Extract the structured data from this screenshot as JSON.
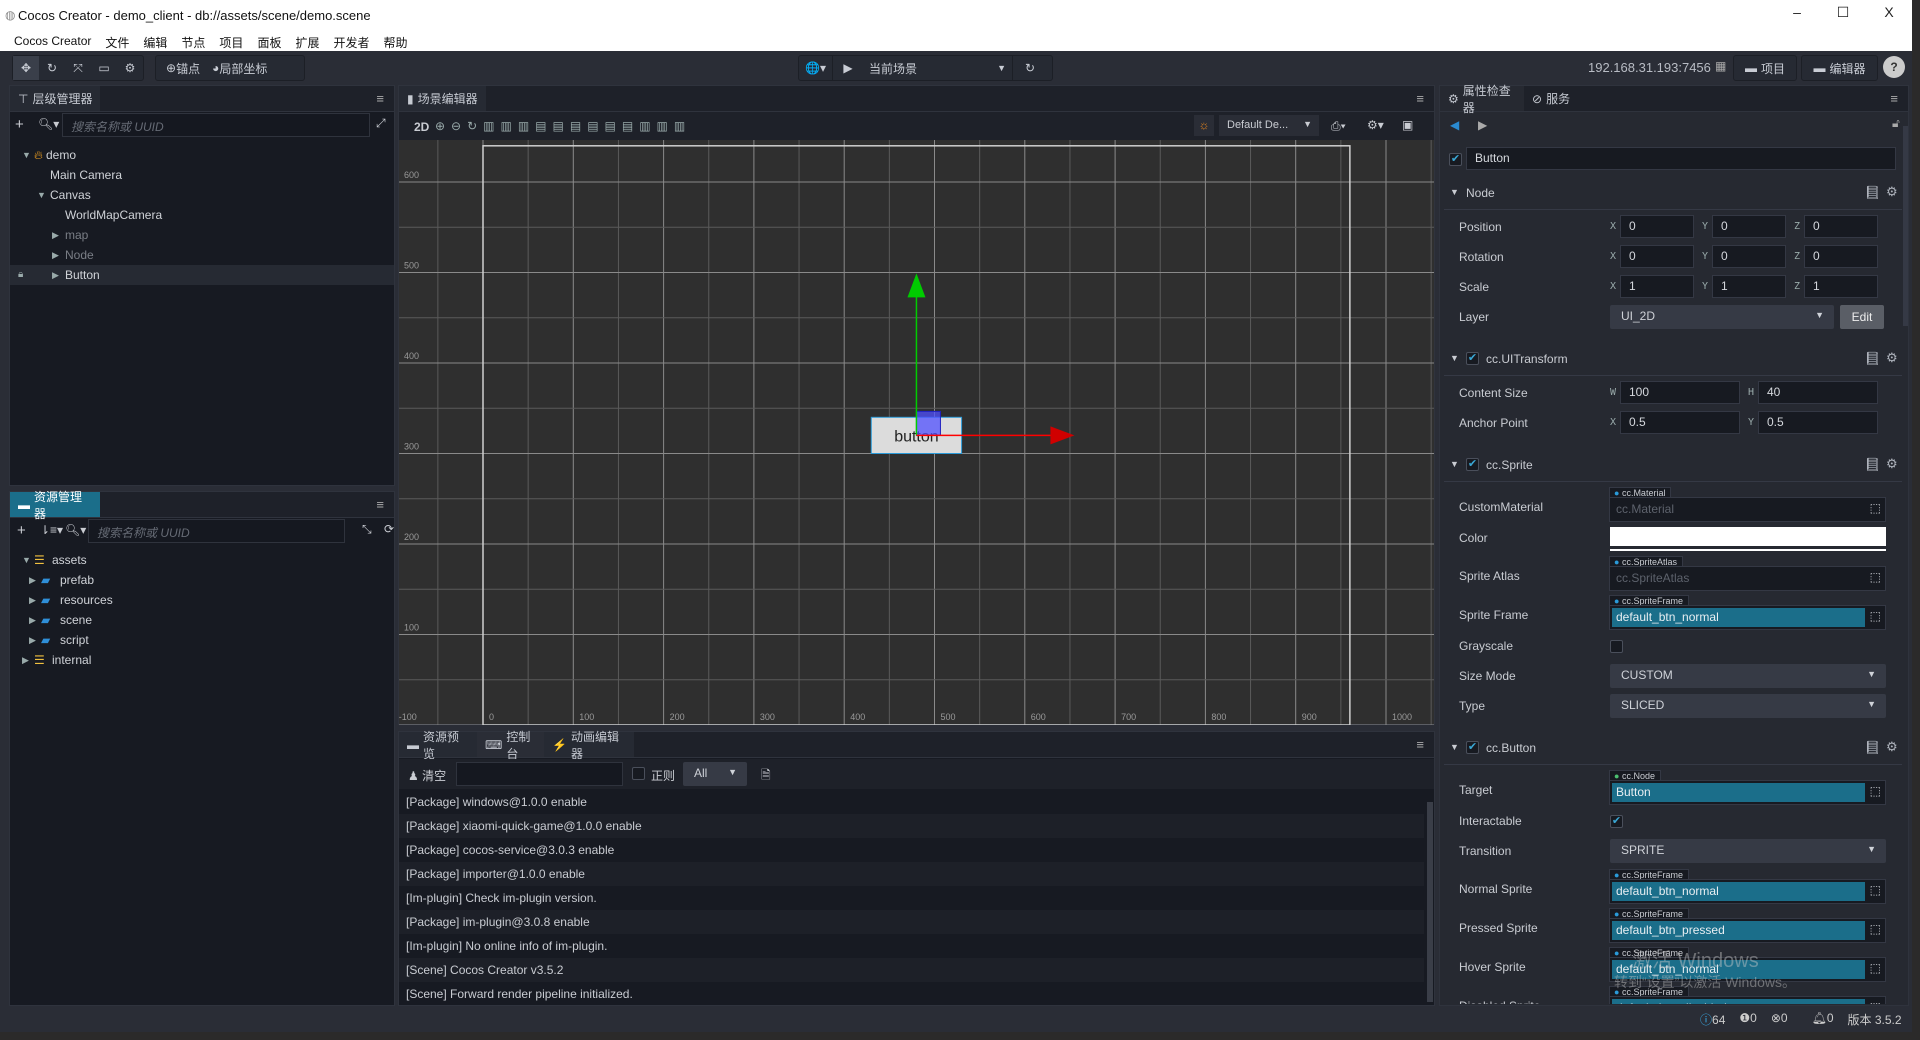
{
  "window": {
    "title": "Cocos Creator - demo_client - db://assets/scene/demo.scene",
    "min": "–",
    "max": "☐",
    "close": "X"
  },
  "menu": [
    "Cocos Creator",
    "文件",
    "编辑",
    "节点",
    "项目",
    "面板",
    "扩展",
    "开发者",
    "帮助"
  ],
  "toolbar": {
    "anchor_label": "锚点",
    "coord_label": "局部坐标",
    "scene_select": "当前场景",
    "ip": "192.168.31.193:7456",
    "project_btn": "项目",
    "editor_btn": "编辑器",
    "help": "?"
  },
  "hierarchy": {
    "tab": "层级管理器",
    "search_placeholder": "搜索名称或 UUID",
    "nodes": [
      {
        "label": "demo",
        "depth": 0,
        "expand": "open",
        "icon": "scene-icon"
      },
      {
        "label": "Main Camera",
        "depth": 1,
        "expand": "none"
      },
      {
        "label": "Canvas",
        "depth": 1,
        "expand": "open"
      },
      {
        "label": "WorldMapCamera",
        "depth": 2,
        "expand": "none"
      },
      {
        "label": "map",
        "depth": 2,
        "expand": "closed",
        "dim": true
      },
      {
        "label": "Node",
        "depth": 2,
        "expand": "closed",
        "dim": true
      },
      {
        "label": "Button",
        "depth": 2,
        "expand": "closed",
        "selected": true,
        "locked": true
      }
    ]
  },
  "assets": {
    "tab": "资源管理器",
    "search_placeholder": "搜索名称或 UUID",
    "items": [
      {
        "label": "assets",
        "depth": 0,
        "expand": "open",
        "icon": "database-icon"
      },
      {
        "label": "prefab",
        "depth": 1,
        "expand": "closed",
        "icon": "folder-icon"
      },
      {
        "label": "resources",
        "depth": 1,
        "expand": "closed",
        "icon": "folder-icon"
      },
      {
        "label": "scene",
        "depth": 1,
        "expand": "closed",
        "icon": "folder-icon"
      },
      {
        "label": "script",
        "depth": 1,
        "expand": "closed",
        "icon": "folder-icon"
      },
      {
        "label": "internal",
        "depth": 0,
        "expand": "closed",
        "icon": "database-icon"
      }
    ]
  },
  "scene": {
    "tab": "场景编辑器",
    "mode": "2D",
    "camera_select": "Default De...",
    "x_ticks": [
      -100,
      0,
      100,
      200,
      300,
      400,
      500,
      600,
      700,
      800,
      900,
      1000
    ],
    "y_ticks": [
      0,
      100,
      200,
      300,
      400,
      500,
      600
    ],
    "design_resolution": [
      960,
      640
    ],
    "node": {
      "label": "button",
      "position": [
        480,
        320
      ],
      "size": [
        100,
        40
      ]
    },
    "colors": {
      "x_axis": "#ff0000",
      "y_axis": "#00cc00",
      "grid": "#2f2f2f"
    }
  },
  "console": {
    "tabs": [
      "资源预览",
      "控制台",
      "动画编辑器"
    ],
    "clear_label": "清空",
    "regex_label": "正则",
    "level_select": "All",
    "logs": [
      "[Package] windows@1.0.0 enable",
      "[Package] xiaomi-quick-game@1.0.0 enable",
      "[Package] cocos-service@3.0.3 enable",
      "[Package] importer@1.0.0 enable",
      "[Im-plugin] Check im-plugin version.",
      "[Package] im-plugin@3.0.8 enable",
      "[Im-plugin] No online info of im-plugin.",
      "[Scene] Cocos Creator v3.5.2",
      "[Scene] Forward render pipeline initialized."
    ]
  },
  "inspector": {
    "tabs": [
      "属性检查器",
      "服务"
    ],
    "node_name": "Button",
    "node_active": true,
    "components": [
      {
        "title": "Node",
        "rows": [
          {
            "type": "vec",
            "label": "Position",
            "fields": [
              [
                "X",
                "0"
              ],
              [
                "Y",
                "0"
              ],
              [
                "Z",
                "0"
              ]
            ]
          },
          {
            "type": "vec",
            "label": "Rotation",
            "fields": [
              [
                "X",
                "0"
              ],
              [
                "Y",
                "0"
              ],
              [
                "Z",
                "0"
              ]
            ]
          },
          {
            "type": "vec",
            "label": "Scale",
            "fields": [
              [
                "X",
                "1"
              ],
              [
                "Y",
                "1"
              ],
              [
                "Z",
                "1"
              ]
            ]
          },
          {
            "type": "select",
            "label": "Layer",
            "value": "UI_2D",
            "button": "Edit"
          }
        ]
      },
      {
        "title": "cc.UITransform",
        "enabled": true,
        "rows": [
          {
            "type": "vec",
            "label": "Content Size",
            "fields": [
              [
                "W",
                "100"
              ],
              [
                "H",
                "40"
              ]
            ]
          },
          {
            "type": "vec",
            "label": "Anchor Point",
            "fields": [
              [
                "X",
                "0.5"
              ],
              [
                "Y",
                "0.5"
              ]
            ]
          }
        ]
      },
      {
        "title": "cc.Sprite",
        "enabled": true,
        "rows": [
          {
            "type": "asset",
            "label": "CustomMaterial",
            "tag": "cc.Material",
            "value": "cc.Material",
            "empty": true
          },
          {
            "type": "color",
            "label": "Color",
            "color": "#ffffff"
          },
          {
            "type": "asset",
            "label": "Sprite Atlas",
            "tag": "cc.SpriteAtlas",
            "value": "cc.SpriteAtlas",
            "empty": true
          },
          {
            "type": "asset",
            "label": "Sprite Frame",
            "tag": "cc.SpriteFrame",
            "value": "default_btn_normal"
          },
          {
            "type": "check",
            "label": "Grayscale",
            "checked": false
          },
          {
            "type": "select",
            "label": "Size Mode",
            "value": "CUSTOM"
          },
          {
            "type": "select",
            "label": "Type",
            "value": "SLICED"
          }
        ]
      },
      {
        "title": "cc.Button",
        "enabled": true,
        "rows": [
          {
            "type": "asset",
            "label": "Target",
            "tag": "cc.Node",
            "value": "Button",
            "node": true
          },
          {
            "type": "check",
            "label": "Interactable",
            "checked": true
          },
          {
            "type": "select",
            "label": "Transition",
            "value": "SPRITE"
          },
          {
            "type": "asset",
            "label": "Normal Sprite",
            "tag": "cc.SpriteFrame",
            "value": "default_btn_normal"
          },
          {
            "type": "asset",
            "label": "Pressed Sprite",
            "tag": "cc.SpriteFrame",
            "value": "default_btn_pressed"
          },
          {
            "type": "asset",
            "label": "Hover Sprite",
            "tag": "cc.SpriteFrame",
            "value": "default_btn_normal"
          },
          {
            "type": "asset",
            "label": "Disabled Sprite",
            "tag": "cc.SpriteFrame",
            "value": "default_btn_disabled"
          }
        ]
      }
    ]
  },
  "watermark": {
    "line1": "激活 Windows",
    "line2": "转到“设置”以激活 Windows。"
  },
  "status": {
    "info": "64",
    "warn": "0",
    "error": "0",
    "notify": "0",
    "version": "版本 3.5.2"
  },
  "colors": {
    "accent": "#1b6e8a",
    "panel": "#171a22",
    "inspector": "#262931"
  }
}
